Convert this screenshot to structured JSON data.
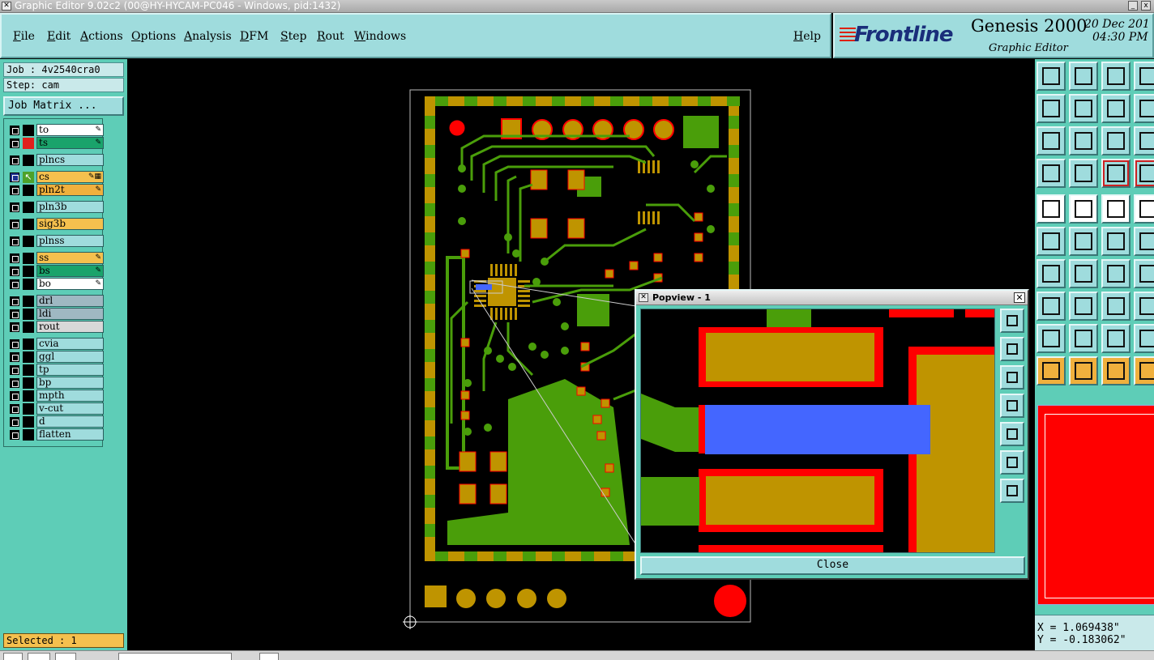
{
  "window": {
    "title": "Graphic Editor 9.02c2 (00@HY-HYCAM-PC046 - Windows, pid:1432)",
    "minimize": "_",
    "close": "x"
  },
  "menu": {
    "items": [
      "File",
      "Edit",
      "Actions",
      "Options",
      "Analysis",
      "DFM",
      "Step",
      "Rout",
      "Windows"
    ],
    "help": "Help"
  },
  "brand": {
    "logo": "Frontline",
    "product": "Genesis 2000",
    "subtitle": "Graphic Editor",
    "date": "20 Dec 201",
    "time": "04:30 PM"
  },
  "job": {
    "job_label": "Job : 4v2540cra0",
    "step_label": "Step: cam",
    "matrix_button": "Job Matrix ..."
  },
  "layers": [
    {
      "name": "to",
      "bg": "#ffffff",
      "color": "#000000",
      "mark": "✎"
    },
    {
      "name": "ts",
      "bg": "#1aa36b",
      "color": "#e0201c",
      "mark": "✎"
    },
    {
      "name": "plncs",
      "bg": "#9fdcdd",
      "color": "#000000",
      "mark": ""
    },
    {
      "name": "cs",
      "bg": "#f5c04e",
      "color": "#4ea12a",
      "mark": "✎▦",
      "active": true
    },
    {
      "name": "pln2t",
      "bg": "#f0b03d",
      "color": "#000000",
      "mark": "✎"
    },
    {
      "name": "pln3b",
      "bg": "#9fdcdd",
      "color": "#000000",
      "mark": ""
    },
    {
      "name": "sig3b",
      "bg": "#f5c04e",
      "color": "#000000",
      "mark": ""
    },
    {
      "name": "plnss",
      "bg": "#9fdcdd",
      "color": "#000000",
      "mark": ""
    },
    {
      "name": "ss",
      "bg": "#f5c04e",
      "color": "#000000",
      "mark": "✎"
    },
    {
      "name": "bs",
      "bg": "#1aa36b",
      "color": "#000000",
      "mark": "✎"
    },
    {
      "name": "bo",
      "bg": "#ffffff",
      "color": "#000000",
      "mark": "✎"
    },
    {
      "name": "drl",
      "bg": "#9fb8c2",
      "color": "#000000",
      "mark": ""
    },
    {
      "name": "ldi",
      "bg": "#9fb8c2",
      "color": "#000000",
      "mark": ""
    },
    {
      "name": "rout",
      "bg": "#d8d8d8",
      "color": "#000000",
      "mark": ""
    },
    {
      "name": "cvia",
      "bg": "#9fdcdd",
      "color": "#000000",
      "mark": ""
    },
    {
      "name": "ggl",
      "bg": "#9fdcdd",
      "color": "#000000",
      "mark": ""
    },
    {
      "name": "tp",
      "bg": "#9fdcdd",
      "color": "#000000",
      "mark": ""
    },
    {
      "name": "bp",
      "bg": "#9fdcdd",
      "color": "#000000",
      "mark": ""
    },
    {
      "name": "mpth",
      "bg": "#9fdcdd",
      "color": "#000000",
      "mark": ""
    },
    {
      "name": "v-cut",
      "bg": "#9fdcdd",
      "color": "#000000",
      "mark": ""
    },
    {
      "name": "d",
      "bg": "#9fdcdd",
      "color": "#000000",
      "mark": ""
    },
    {
      "name": "flatten",
      "bg": "#9fdcdd",
      "color": "#000000",
      "mark": ""
    }
  ],
  "status": {
    "selected": "Selected : 1"
  },
  "coords": {
    "x": "X = 1.069438\"",
    "y": "Y = -0.183062\""
  },
  "popview": {
    "title": "Popview - 1",
    "close": "Close"
  },
  "colors": {
    "copper": "#bf9400",
    "fill": "#4a9e0a",
    "pad_red": "#ff0000",
    "selected": "#4466ff",
    "panel": "#5ecdb7",
    "button": "#9fdcdd"
  }
}
